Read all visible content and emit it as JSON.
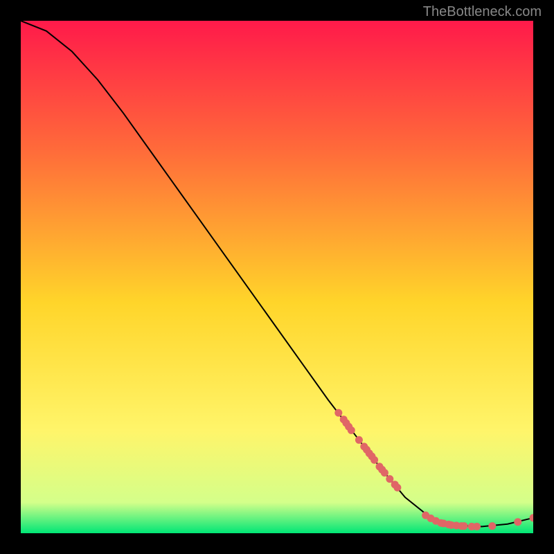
{
  "watermark": "TheBottleneck.com",
  "chart_data": {
    "type": "line",
    "title": "",
    "xlabel": "",
    "ylabel": "",
    "xlim": [
      0,
      100
    ],
    "ylim": [
      0,
      100
    ],
    "background_gradient": {
      "top": "#ff1a4a",
      "mid_top": "#ff6a3a",
      "mid": "#ffd52a",
      "mid_bottom": "#fff56a",
      "bottom_band": "#d4ff8a",
      "bottom": "#00e676"
    },
    "curve": [
      {
        "x": 0,
        "y": 100
      },
      {
        "x": 5,
        "y": 98
      },
      {
        "x": 10,
        "y": 94
      },
      {
        "x": 15,
        "y": 88.5
      },
      {
        "x": 20,
        "y": 82
      },
      {
        "x": 25,
        "y": 75
      },
      {
        "x": 30,
        "y": 68
      },
      {
        "x": 35,
        "y": 61
      },
      {
        "x": 40,
        "y": 54
      },
      {
        "x": 45,
        "y": 47
      },
      {
        "x": 50,
        "y": 40
      },
      {
        "x": 55,
        "y": 33
      },
      {
        "x": 60,
        "y": 26
      },
      {
        "x": 65,
        "y": 19.5
      },
      {
        "x": 70,
        "y": 13
      },
      {
        "x": 75,
        "y": 7
      },
      {
        "x": 80,
        "y": 3
      },
      {
        "x": 85,
        "y": 1.5
      },
      {
        "x": 90,
        "y": 1.3
      },
      {
        "x": 95,
        "y": 1.8
      },
      {
        "x": 100,
        "y": 3
      }
    ],
    "points": [
      {
        "x": 62,
        "y": 23.5
      },
      {
        "x": 63,
        "y": 22.2
      },
      {
        "x": 63.5,
        "y": 21.5
      },
      {
        "x": 64,
        "y": 20.8
      },
      {
        "x": 64.5,
        "y": 20.1
      },
      {
        "x": 66,
        "y": 18.2
      },
      {
        "x": 67,
        "y": 16.9
      },
      {
        "x": 67.5,
        "y": 16.3
      },
      {
        "x": 68,
        "y": 15.6
      },
      {
        "x": 68.5,
        "y": 15.0
      },
      {
        "x": 69,
        "y": 14.3
      },
      {
        "x": 70,
        "y": 13.0
      },
      {
        "x": 70.5,
        "y": 12.4
      },
      {
        "x": 71,
        "y": 11.8
      },
      {
        "x": 72,
        "y": 10.6
      },
      {
        "x": 73,
        "y": 9.5
      },
      {
        "x": 73.5,
        "y": 8.9
      },
      {
        "x": 79,
        "y": 3.5
      },
      {
        "x": 80,
        "y": 2.9
      },
      {
        "x": 81,
        "y": 2.4
      },
      {
        "x": 82,
        "y": 2.0
      },
      {
        "x": 82.5,
        "y": 1.9
      },
      {
        "x": 83.5,
        "y": 1.7
      },
      {
        "x": 84,
        "y": 1.6
      },
      {
        "x": 85,
        "y": 1.5
      },
      {
        "x": 86,
        "y": 1.4
      },
      {
        "x": 86.5,
        "y": 1.4
      },
      {
        "x": 88,
        "y": 1.3
      },
      {
        "x": 89,
        "y": 1.3
      },
      {
        "x": 92,
        "y": 1.4
      },
      {
        "x": 97,
        "y": 2.2
      },
      {
        "x": 100,
        "y": 3.0
      }
    ],
    "point_color": "#e06666",
    "curve_color": "#000000"
  }
}
